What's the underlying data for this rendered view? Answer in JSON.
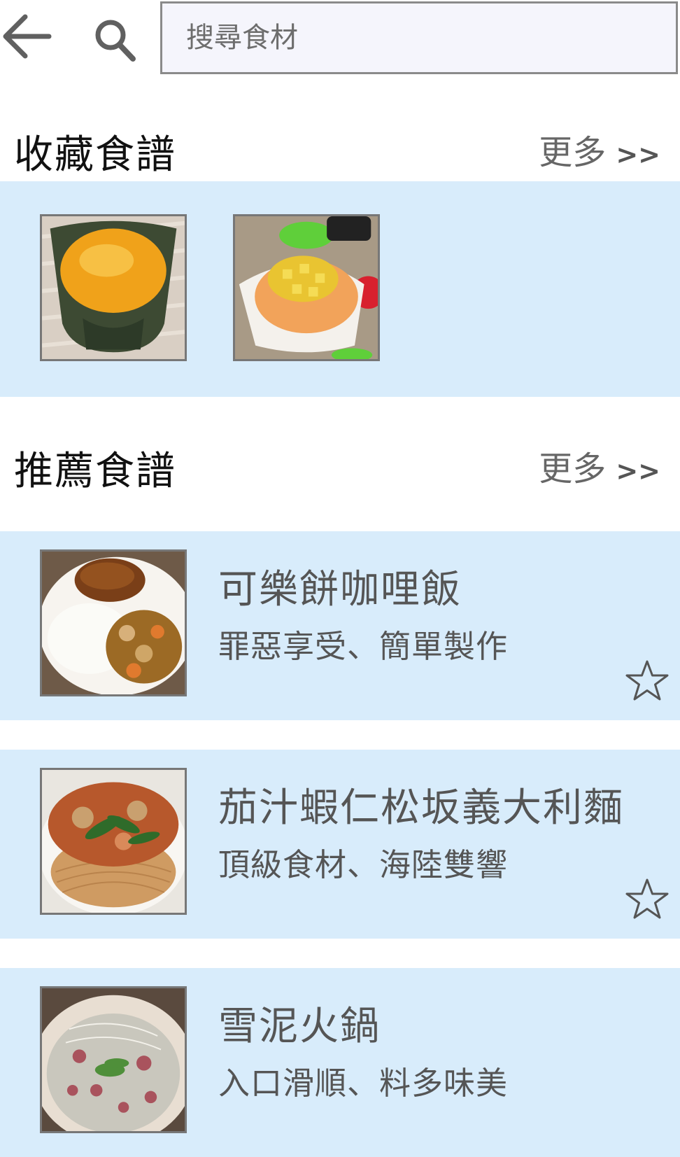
{
  "header": {
    "back_icon": "arrow-left-icon",
    "search_icon": "magnifier-icon",
    "search_placeholder": "搜尋食材",
    "search_value": ""
  },
  "favorites": {
    "title": "收藏食譜",
    "more_label": "更多",
    "more_arrows": ">>",
    "items": [
      {
        "image": "mango-juice-photo"
      },
      {
        "image": "mango-shaved-ice-photo"
      }
    ]
  },
  "recommended": {
    "title": "推薦食譜",
    "more_label": "更多",
    "more_arrows": ">>",
    "items": [
      {
        "title": "可樂餅咖哩飯",
        "subtitle": "罪惡享受、簡單製作",
        "image": "croquette-curry-rice-photo",
        "favorite_icon": "star-outline-icon"
      },
      {
        "title": "茄汁蝦仁松坂義大利麵",
        "subtitle": "頂級食材、海陸雙響",
        "image": "tomato-shrimp-pasta-photo",
        "favorite_icon": "star-outline-icon"
      },
      {
        "title": "雪泥火鍋",
        "subtitle": "入口滑順、料多味美",
        "image": "hotpot-photo"
      }
    ]
  },
  "colors": {
    "band": "#d8ecfb",
    "search_bg": "#f5f5fc",
    "border": "#8a8a8a",
    "muted_text": "#555555"
  }
}
